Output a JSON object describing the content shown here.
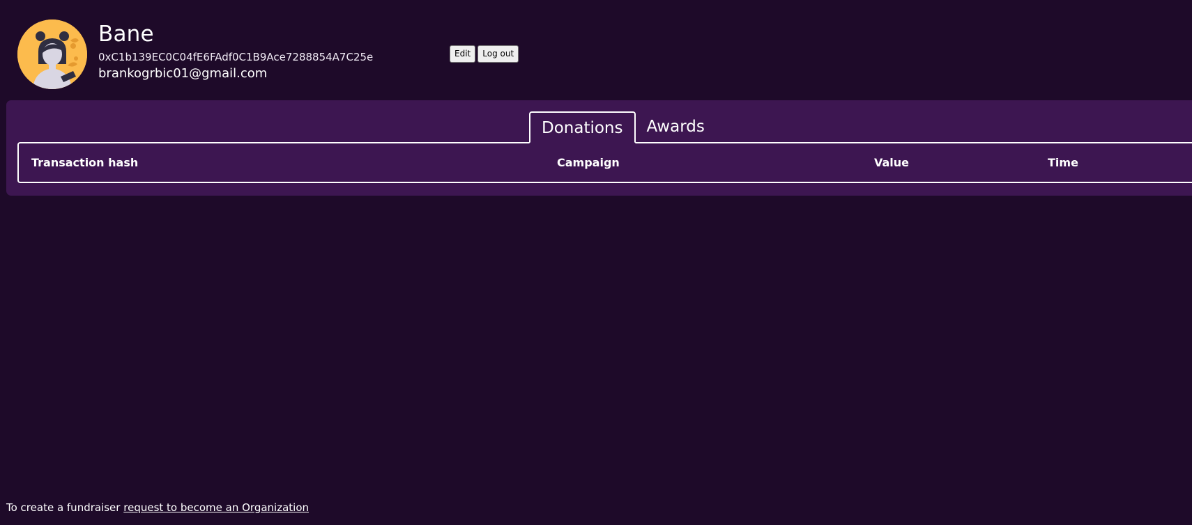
{
  "profile": {
    "name": "Bane",
    "address": "0xC1b139EC0C04fE6FAdf0C1B9Ace7288854A7C25e",
    "email": "brankogrbic01@gmail.com",
    "avatar_icon": "avatar-illustration-icon"
  },
  "actions": {
    "edit_label": "Edit",
    "logout_label": "Log out"
  },
  "tabs": [
    {
      "label": "Donations",
      "active": true
    },
    {
      "label": "Awards",
      "active": false
    }
  ],
  "table": {
    "columns": [
      "Transaction hash",
      "Campaign",
      "Value",
      "Time"
    ],
    "rows": []
  },
  "footer": {
    "prefix": "To create a fundraiser",
    "link_text": "request to become an Organization"
  },
  "colors": {
    "background": "#1e0a29",
    "panel": "#3d1651",
    "avatar_bg": "#fcbb4d",
    "text": "#ffffff"
  }
}
